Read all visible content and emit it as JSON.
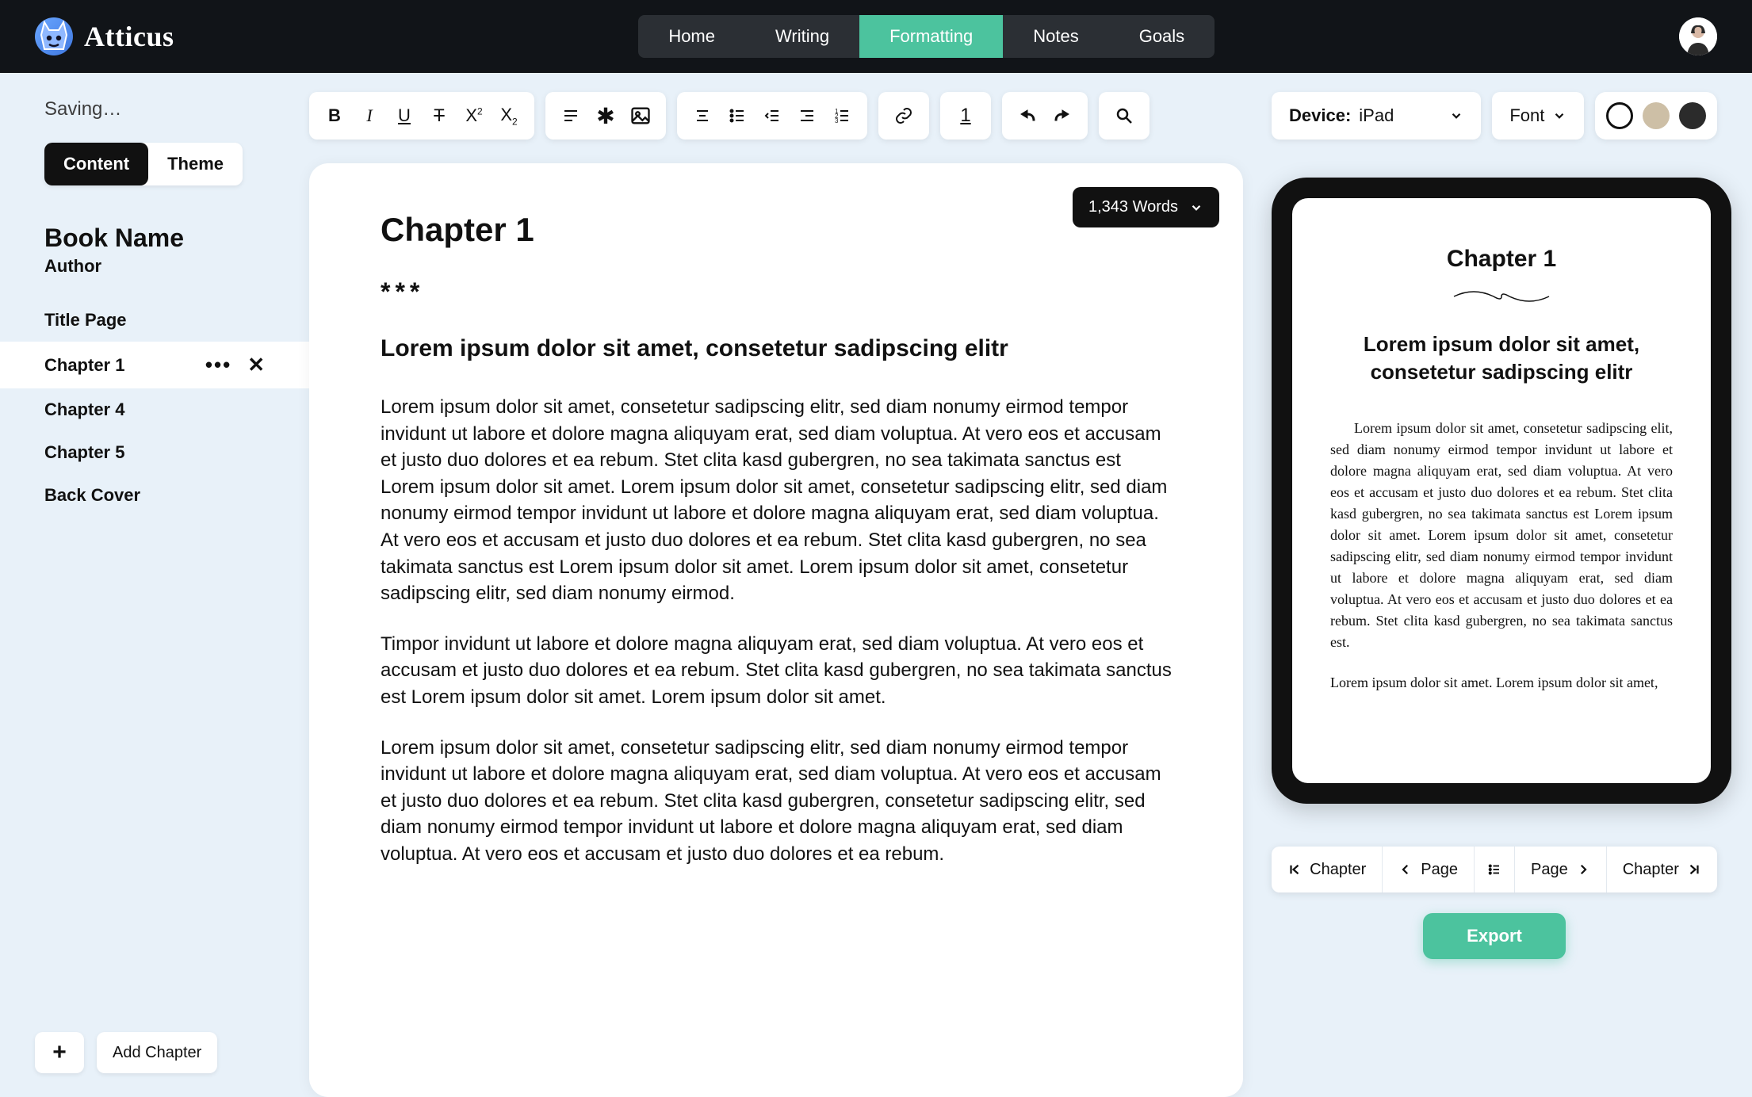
{
  "app_name": "Atticus",
  "nav": [
    "Home",
    "Writing",
    "Formatting",
    "Notes",
    "Goals"
  ],
  "nav_active_index": 2,
  "saving_label": "Saving…",
  "tabs": {
    "content": "Content",
    "theme": "Theme",
    "active": "content"
  },
  "book": {
    "title": "Book Name",
    "author": "Author"
  },
  "sidebar_items": [
    {
      "label": "Title Page"
    },
    {
      "label": "Chapter 1",
      "active": true
    },
    {
      "label": "Chapter 4"
    },
    {
      "label": "Chapter 5"
    },
    {
      "label": "Back Cover"
    }
  ],
  "add_chapter_label": "Add Chapter",
  "word_count_label": "1,343 Words",
  "editor": {
    "title": "Chapter 1",
    "scene_break": "***",
    "subhead": "Lorem ipsum dolor sit amet, consetetur sadipscing elitr",
    "p1": "Lorem ipsum dolor sit amet, consetetur sadipscing elitr, sed diam nonumy eirmod tempor invidunt ut labore et dolore magna aliquyam erat, sed diam voluptua. At vero eos et accusam et justo duo dolores et ea rebum. Stet clita kasd gubergren, no sea takimata sanctus est Lorem ipsum dolor sit amet. Lorem ipsum dolor sit amet, consetetur sadipscing elitr, sed diam nonumy eirmod tempor invidunt ut labore et dolore magna aliquyam erat, sed diam voluptua. At vero eos et accusam et justo duo dolores et ea rebum. Stet clita kasd gubergren, no sea takimata sanctus est Lorem ipsum dolor sit amet. Lorem ipsum dolor sit amet, consetetur sadipscing elitr, sed diam nonumy eirmod.",
    "p2": "Timpor invidunt ut labore et dolore magna aliquyam erat, sed diam voluptua. At vero eos et accusam et justo duo dolores et ea rebum. Stet clita kasd gubergren, no sea takimata sanctus est Lorem ipsum dolor sit amet. Lorem ipsum dolor sit amet.",
    "p3": "Lorem ipsum dolor sit amet, consetetur sadipscing elitr, sed diam nonumy eirmod tempor invidunt ut labore et dolore magna aliquyam erat, sed diam voluptua. At vero eos et accusam et justo duo dolores et ea rebum. Stet clita kasd gubergren, consetetur sadipscing elitr, sed diam nonumy eirmod tempor invidunt ut labore et dolore magna aliquyam erat, sed diam voluptua. At vero eos et accusam et justo duo dolores et ea rebum."
  },
  "preview_controls": {
    "device_label": "Device:",
    "device_value": "iPad",
    "font_label": "Font"
  },
  "preview": {
    "title": "Chapter 1",
    "subhead": "Lorem ipsum dolor sit amet, consetetur sadipscing elitr",
    "p1": "Lorem ipsum dolor sit amet, consetetur sadipscing elit, sed diam nonumy eirmod tempor invidunt ut labore et dolore magna aliquyam erat, sed diam voluptua. At vero eos et accusam et justo duo dolores et ea rebum. Stet clita kasd gubergren, no sea takimata sanctus est Lorem ipsum dolor sit amet. Lorem ipsum dolor sit amet, consetetur sadipscing elitr, sed diam nonumy eirmod tempor invidunt ut labore et dolore magna aliquyam erat, sed diam voluptua. At vero eos et accusam et justo duo dolores et ea rebum. Stet clita kasd gubergren, no sea takimata sanctus est.",
    "p2": "Lorem ipsum dolor sit amet. Lorem ipsum dolor sit amet,"
  },
  "pageflip": {
    "chapter_prev": "Chapter",
    "page_prev": "Page",
    "page_next": "Page",
    "chapter_next": "Chapter"
  },
  "export_label": "Export"
}
